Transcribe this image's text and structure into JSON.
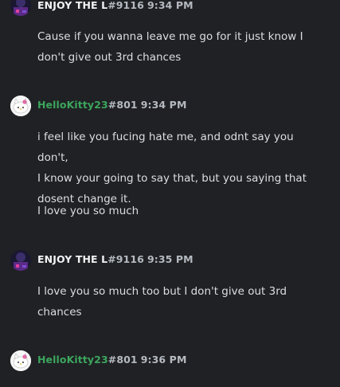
{
  "messages": [
    {
      "author": "ENJOY THE L",
      "discriminator": "#9116",
      "time": "9:34 PM",
      "lines": [
        "Cause if you wanna leave me go for it just know I",
        "don't give out 3rd chances"
      ]
    },
    {
      "author": "HelloKitty23",
      "discriminator": "#801",
      "time": "9:34 PM",
      "lines": [
        "i feel like you fucing hate me, and odnt say you don't,",
        "I know your going to say that, but you saying that",
        "dosent change it."
      ],
      "lines2": [
        "I love you so much"
      ]
    },
    {
      "author": "ENJOY THE L",
      "discriminator": "#9116",
      "time": "9:35 PM",
      "lines": [
        "I love you so much too but I don't give out 3rd",
        "chances"
      ]
    },
    {
      "author": "HelloKitty23",
      "discriminator": "#801",
      "time": "9:36 PM",
      "lines": []
    }
  ],
  "colors": {
    "background": "#202124",
    "author_white": "#f2f3f5",
    "author_green": "#3ba55d",
    "meta": "#b5bac1",
    "text": "#dbdee1"
  },
  "icons": {
    "avatar_enjoy": "dark-purple-avatar-icon",
    "avatar_hellokitty": "hello-kitty-avatar-icon"
  }
}
